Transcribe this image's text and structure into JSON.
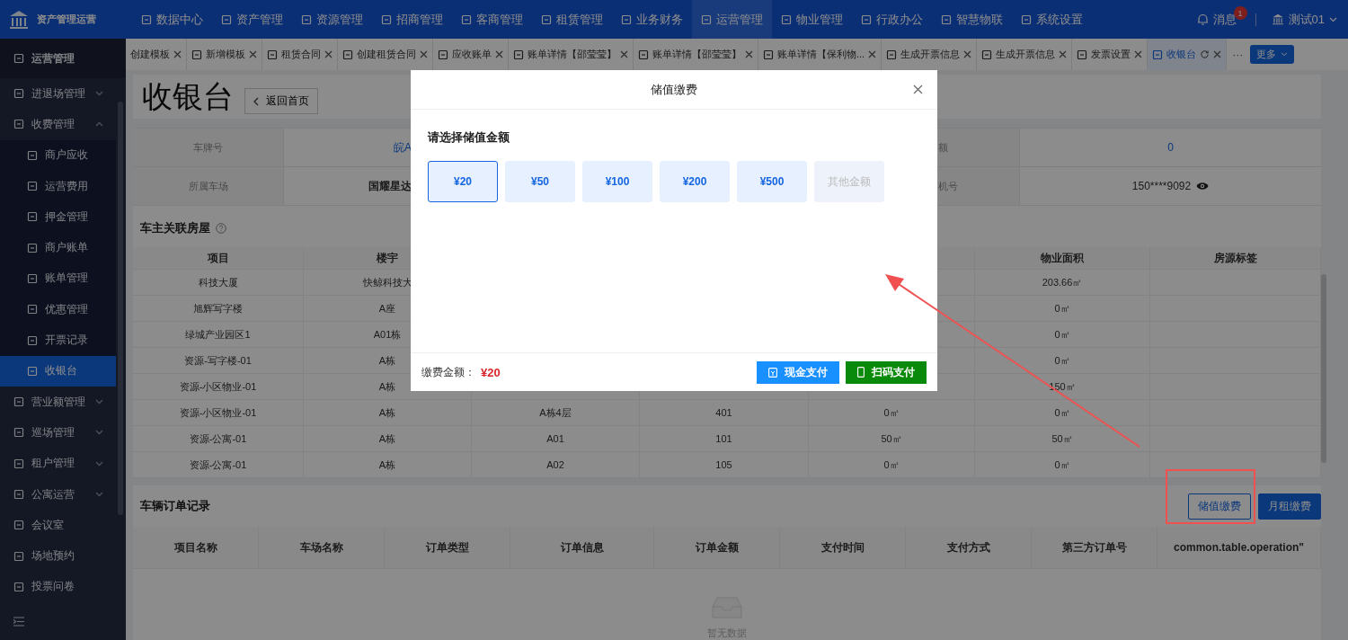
{
  "top_nav": {
    "brand": "资产管理运营",
    "items": [
      {
        "label": "数据中心",
        "selected": false
      },
      {
        "label": "资产管理",
        "selected": false
      },
      {
        "label": "资源管理",
        "selected": false
      },
      {
        "label": "招商管理",
        "selected": false
      },
      {
        "label": "客商管理",
        "selected": false
      },
      {
        "label": "租赁管理",
        "selected": false
      },
      {
        "label": "业务财务",
        "selected": false
      },
      {
        "label": "运营管理",
        "selected": true
      },
      {
        "label": "物业管理",
        "selected": false
      },
      {
        "label": "行政办公",
        "selected": false
      },
      {
        "label": "智慧物联",
        "selected": false
      },
      {
        "label": "系统设置",
        "selected": false
      }
    ],
    "messages": {
      "label": "消息",
      "badge": "1"
    },
    "user": "测试01"
  },
  "sidebar": {
    "header": "运营管理",
    "items": [
      {
        "label": "进退场管理",
        "expanded": false,
        "selected": false
      },
      {
        "label": "收费管理",
        "expanded": true,
        "selected": false,
        "children": [
          {
            "label": "商户应收",
            "selected": false
          },
          {
            "label": "运营费用",
            "selected": false
          },
          {
            "label": "押金管理",
            "selected": false
          },
          {
            "label": "商户账单",
            "selected": false
          },
          {
            "label": "账单管理",
            "selected": false
          },
          {
            "label": "优惠管理",
            "selected": false
          },
          {
            "label": "开票记录",
            "selected": false
          },
          {
            "label": "收银台",
            "selected": true
          }
        ]
      },
      {
        "label": "营业额管理",
        "expanded": false,
        "selected": false
      },
      {
        "label": "巡场管理",
        "expanded": false,
        "selected": false
      },
      {
        "label": "租户管理",
        "expanded": false,
        "selected": false
      },
      {
        "label": "公寓运营",
        "expanded": false,
        "selected": false
      },
      {
        "label": "会议室",
        "selected": false
      },
      {
        "label": "场地预约",
        "selected": false
      },
      {
        "label": "投票问卷",
        "selected": false
      }
    ]
  },
  "tabs": [
    {
      "label": "创建模板",
      "selected": false
    },
    {
      "label": "新增模板",
      "selected": false
    },
    {
      "label": "租赁合同",
      "selected": false
    },
    {
      "label": "创建租赁合同",
      "selected": false
    },
    {
      "label": "应收账单",
      "selected": false
    },
    {
      "label": "账单详情【邵莹莹】",
      "selected": false
    },
    {
      "label": "账单详情【邵莹莹】",
      "selected": false
    },
    {
      "label": "账单详情【保利物...",
      "selected": false
    },
    {
      "label": "生成开票信息",
      "selected": false
    },
    {
      "label": "生成开票信息",
      "selected": false
    },
    {
      "label": "发票设置",
      "selected": false
    },
    {
      "label": "收银台",
      "selected": true
    }
  ],
  "tabs_more": {
    "ellipsis": "···",
    "button": "更多"
  },
  "page": {
    "title": "收银台",
    "back_button": "返回首页"
  },
  "vehicle_info": {
    "rows": [
      [
        {
          "label": "车牌号",
          "value": "皖A",
          "link": true
        },
        {
          "label": "额",
          "value": "0",
          "link": true
        }
      ],
      [
        {
          "label": "所属车场",
          "value": "国耀星达",
          "link": false
        },
        {
          "label": "机号",
          "value": "150****9092",
          "link": false,
          "reveal_toggle": true
        }
      ]
    ]
  },
  "houses": {
    "title": "车主关联房屋",
    "columns": [
      "项目",
      "楼宇",
      null,
      null,
      null,
      "物业面积",
      "房源标签"
    ],
    "rows": [
      [
        "科技大厦",
        "快鲸科技大",
        null,
        null,
        null,
        "203.66㎡",
        null
      ],
      [
        "旭辉写字楼",
        "A座",
        null,
        null,
        null,
        "0㎡",
        null
      ],
      [
        "绿城产业园区1",
        "A01栋",
        null,
        null,
        null,
        "0㎡",
        null
      ],
      [
        "资源-写字楼-01",
        "A栋",
        null,
        null,
        null,
        "0㎡",
        null
      ],
      [
        "资源-小区物业-01",
        "A栋",
        null,
        null,
        null,
        "150㎡",
        null
      ],
      [
        "资源-小区物业-01",
        "A栋",
        "A栋4层",
        "401",
        "0㎡",
        "0㎡",
        null
      ],
      [
        "资源-公寓-01",
        "A栋",
        "A01",
        "101",
        "50㎡",
        "50㎡",
        null
      ],
      [
        "资源-公寓-01",
        "A栋",
        "A02",
        "105",
        "0㎡",
        "0㎡",
        null
      ]
    ]
  },
  "orders": {
    "title": "车辆订单记录",
    "buttons": [
      {
        "label": "储值缴费",
        "kind": "outline"
      },
      {
        "label": "月租缴费",
        "kind": "primary"
      }
    ],
    "columns": [
      "项目名称",
      "车场名称",
      "订单类型",
      "订单信息",
      "订单金额",
      "支付时间",
      "支付方式",
      "第三方订单号",
      "common.table.operation\""
    ],
    "empty_text": "暂无数据"
  },
  "dialog": {
    "title": "储值缴费",
    "prompt": "请选择储值金额",
    "amounts": [
      {
        "label": "¥20",
        "selected": true,
        "disabled": false
      },
      {
        "label": "¥50",
        "selected": false,
        "disabled": false
      },
      {
        "label": "¥100",
        "selected": false,
        "disabled": false
      },
      {
        "label": "¥200",
        "selected": false,
        "disabled": false
      },
      {
        "label": "¥500",
        "selected": false,
        "disabled": false
      },
      {
        "label": "其他金额",
        "selected": false,
        "disabled": true
      }
    ],
    "total_label": "缴费金额：",
    "total": "¥20",
    "buttons": [
      {
        "label": "现金支付",
        "kind": "cash"
      },
      {
        "label": "扫码支付",
        "kind": "scan"
      }
    ]
  }
}
